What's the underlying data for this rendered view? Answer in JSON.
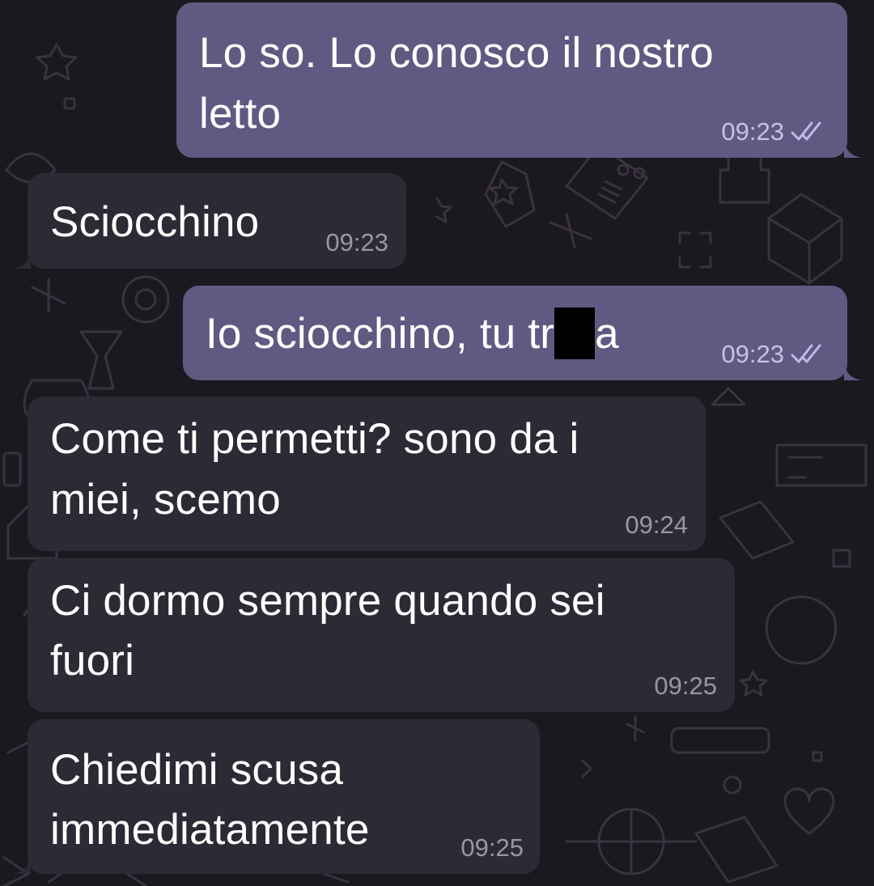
{
  "theme": {
    "background": "#1b1820",
    "outgoing_bubble": "#625982",
    "incoming_bubble": "#2d2a36",
    "read_check_color": "#c3b8ef"
  },
  "messages": [
    {
      "direction": "outgoing",
      "lines": [
        "Lo so. Lo conosco il nostro",
        "letto"
      ],
      "time": "09:23",
      "status": "read-double-check-icon"
    },
    {
      "direction": "incoming",
      "lines": [
        "Sciocchino"
      ],
      "time": "09:23"
    },
    {
      "direction": "outgoing",
      "text_before_redaction": "Io sciocchino, tu tr",
      "text_after_redaction": "a",
      "time": "09:23",
      "status": "read-double-check-icon"
    },
    {
      "direction": "incoming",
      "lines": [
        "Come ti permetti? sono da i",
        "miei, scemo"
      ],
      "time": "09:24"
    },
    {
      "direction": "incoming",
      "lines": [
        "Ci dormo sempre quando sei",
        "fuori"
      ],
      "time": "09:25"
    },
    {
      "direction": "incoming",
      "lines": [
        "Chiedimi scusa",
        "immediatamente"
      ],
      "time": "09:25"
    }
  ]
}
